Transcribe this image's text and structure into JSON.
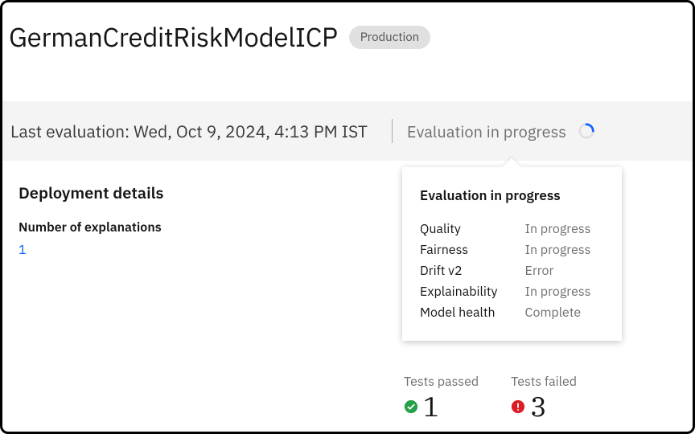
{
  "header": {
    "title": "GermanCreditRiskModelICP",
    "badge": "Production"
  },
  "evalBar": {
    "lastEvaluationLabel": "Last evaluation: ",
    "lastEvaluationValue": "Wed, Oct 9, 2024, 4:13 PM IST",
    "inProgressLabel": "Evaluation in progress"
  },
  "deployment": {
    "heading": "Deployment details",
    "explanationsLabel": "Number of explanations",
    "explanationsValue": "1"
  },
  "popover": {
    "title": "Evaluation in progress",
    "rows": [
      {
        "label": "Quality",
        "status": "In progress"
      },
      {
        "label": "Fairness",
        "status": "In progress"
      },
      {
        "label": "Drift v2",
        "status": "Error"
      },
      {
        "label": "Explainability",
        "status": "In progress"
      },
      {
        "label": "Model health",
        "status": "Complete"
      }
    ]
  },
  "tests": {
    "passedLabel": "Tests passed",
    "passedValue": "1",
    "failedLabel": "Tests failed",
    "failedValue": "3"
  }
}
